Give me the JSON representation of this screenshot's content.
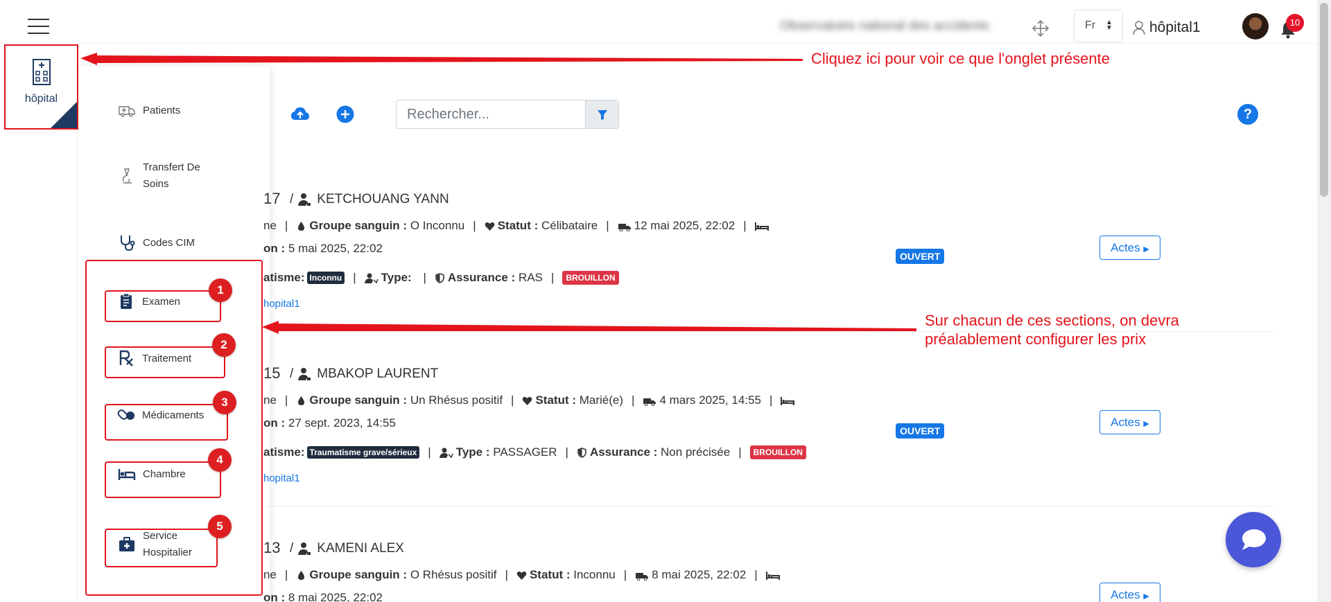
{
  "header": {
    "org_name": "Observatoire national des accidents",
    "language": "Fr",
    "user_name": "hôpital1",
    "notifications_count": "10"
  },
  "module_tile": {
    "label": "hôpital"
  },
  "menu": {
    "items": [
      {
        "label": "Patients",
        "icon": "ambulance-icon"
      },
      {
        "label": "Transfert De Soins",
        "icon": "microscope-icon"
      },
      {
        "label": "Codes CIM",
        "icon": "stethoscope-icon"
      },
      {
        "label": "Examen",
        "icon": "clipboard-icon",
        "badge": "1"
      },
      {
        "label": "Traitement",
        "icon": "prescription-icon",
        "badge": "2"
      },
      {
        "label": "Médicaments",
        "icon": "pills-icon",
        "badge": "3"
      },
      {
        "label": "Chambre",
        "icon": "bed-icon",
        "badge": "4"
      },
      {
        "label": "Service Hospitalier",
        "icon": "medkit-icon",
        "badge": "5"
      }
    ]
  },
  "annotations": {
    "tile_note": "Cliquez ici pour voir ce que l'onglet présente",
    "sections_note_line1": "Sur chacun de ces sections, on devra",
    "sections_note_line2": "préalablement configurer les prix"
  },
  "search": {
    "placeholder": "Rechercher..."
  },
  "help_label": "?",
  "records": [
    {
      "id_suffix": "17",
      "name": "KETCHOUANG YANN",
      "line1": {
        "lead": "ne",
        "blood_label": "Groupe sanguin :",
        "blood": "O Inconnu",
        "status_label": "Statut :",
        "status": "Célibataire",
        "admission": "12 mai 2025, 22:02"
      },
      "line2": {
        "lead": "on :",
        "date": "5 mai 2025, 22:02"
      },
      "line3": {
        "lead": "atisme:",
        "trauma": "Inconnu",
        "type_label": "Type:",
        "type": "",
        "insurance_label": "Assurance :",
        "insurance": "RAS",
        "state": "BROUILLON"
      },
      "link": "hopital1",
      "badge": "OUVERT",
      "actes": "Actes"
    },
    {
      "id_suffix": "15",
      "name": "MBAKOP LAURENT",
      "line1": {
        "lead": "ne",
        "blood_label": "Groupe sanguin :",
        "blood": "Un Rhésus positif",
        "status_label": "Statut :",
        "status": "Marié(e)",
        "admission": "4 mars 2025, 14:55"
      },
      "line2": {
        "lead": "on :",
        "date": "27 sept. 2023, 14:55"
      },
      "line3": {
        "lead": "atisme:",
        "trauma": "Traumatisme grave/sérieux",
        "type_label": "Type :",
        "type": "PASSAGER",
        "insurance_label": "Assurance :",
        "insurance": "Non précisée",
        "state": "BROUILLON"
      },
      "link": "hopital1",
      "badge": "OUVERT",
      "actes": "Actes"
    },
    {
      "id_suffix": "13",
      "name": "KAMENI ALEX",
      "line1": {
        "lead": "ne",
        "blood_label": "Groupe sanguin :",
        "blood": "O Rhésus positif",
        "status_label": "Statut :",
        "status": "Inconnu",
        "admission": "8 mai 2025, 22:02"
      },
      "line2": {
        "lead": "on :",
        "date": "8 mai 2025, 22:02"
      },
      "actes": "Actes"
    }
  ],
  "colors": {
    "accent": "#1677e6",
    "annotation_red": "#e3141c",
    "navy": "#1e3a62",
    "chat": "#4a57d9"
  }
}
